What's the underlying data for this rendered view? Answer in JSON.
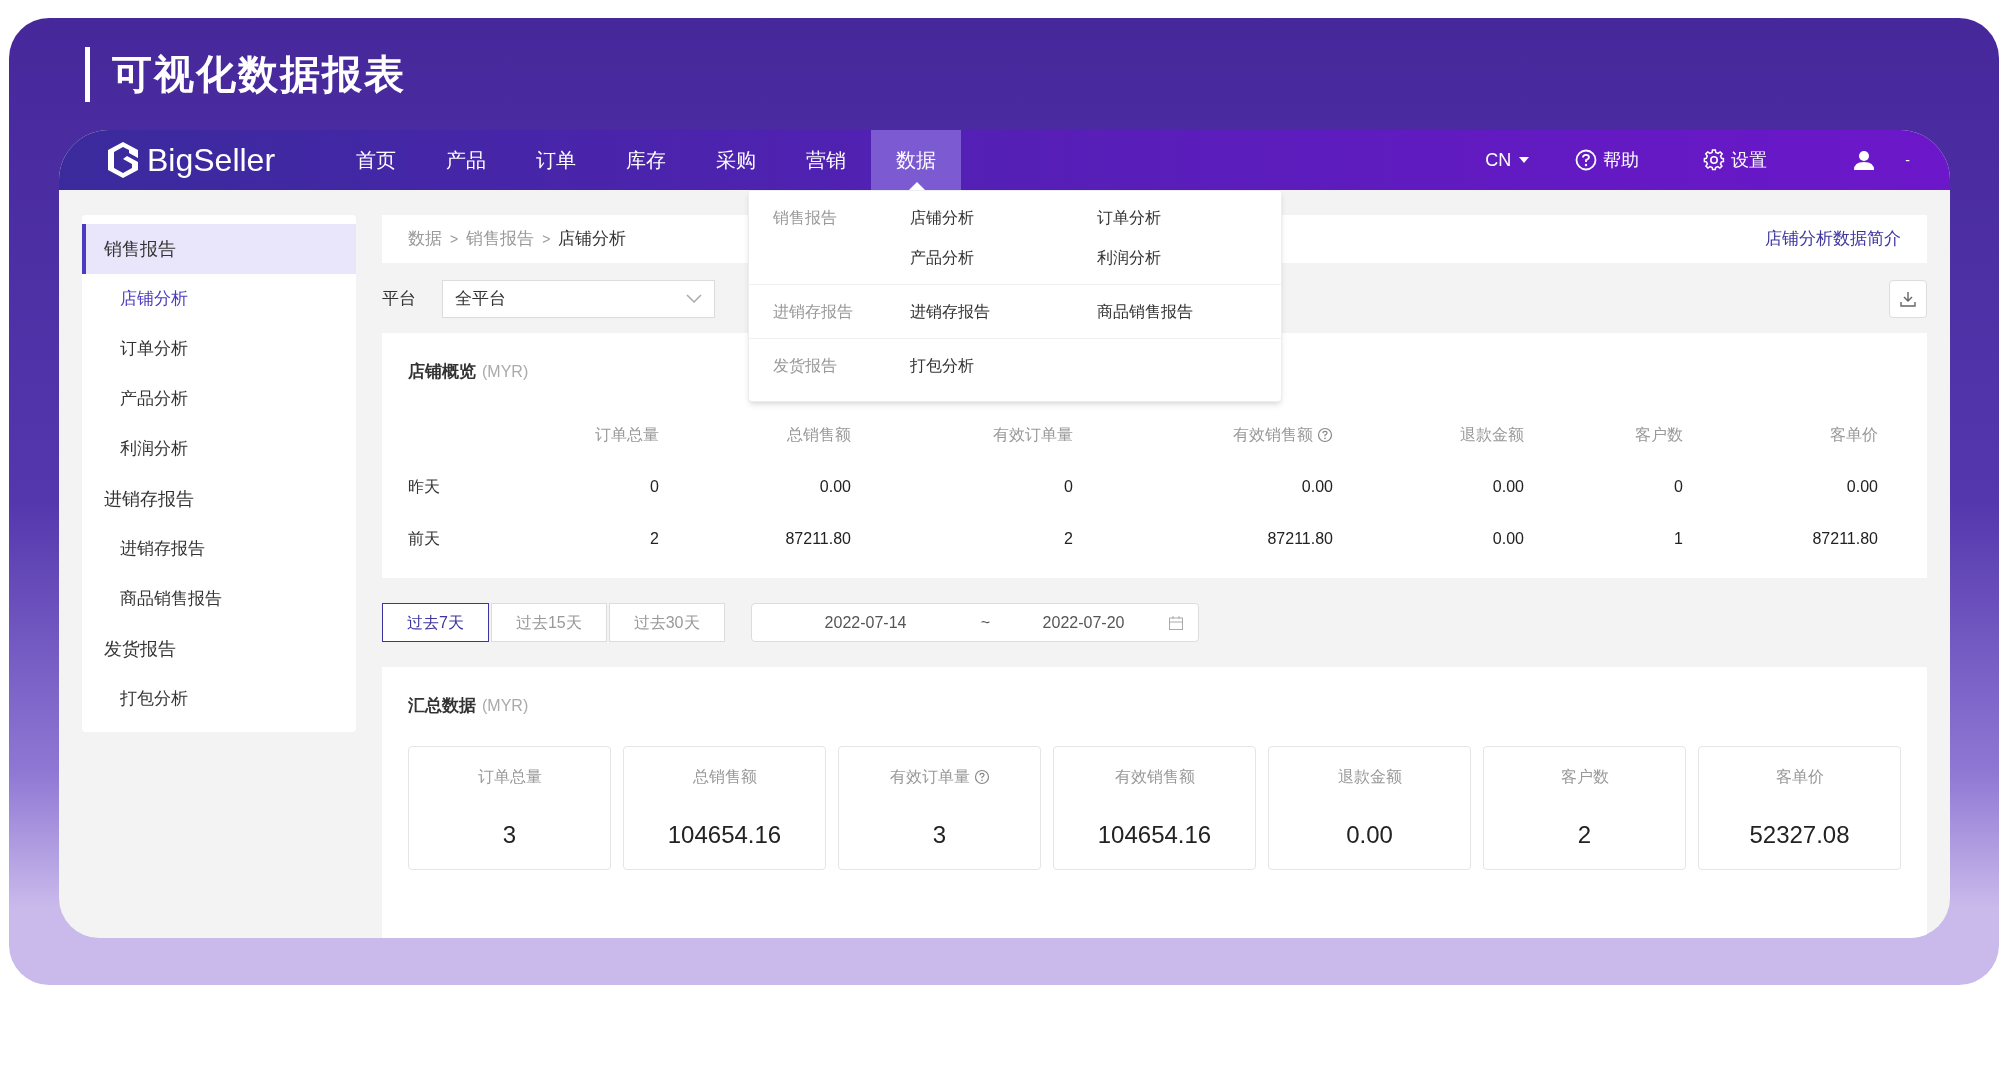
{
  "banner": {
    "title": "可视化数据报表"
  },
  "navbar": {
    "logo": "BigSeller",
    "items": [
      {
        "label": "首页",
        "selected": false
      },
      {
        "label": "产品",
        "selected": false
      },
      {
        "label": "订单",
        "selected": false
      },
      {
        "label": "库存",
        "selected": false
      },
      {
        "label": "采购",
        "selected": false
      },
      {
        "label": "营销",
        "selected": false
      },
      {
        "label": "数据",
        "selected": true
      }
    ],
    "language": "CN",
    "help": "帮助",
    "settings": "设置",
    "user": "-"
  },
  "nav_menu": {
    "groups": [
      {
        "title": "销售报告",
        "items": [
          "店铺分析",
          "订单分析",
          "产品分析",
          "利润分析"
        ]
      },
      {
        "title": "进销存报告",
        "items": [
          "进销存报告",
          "商品销售报告"
        ]
      },
      {
        "title": "发货报告",
        "items": [
          "打包分析"
        ]
      }
    ]
  },
  "sidebar": {
    "groups": [
      {
        "label": "销售报告",
        "selected": true,
        "children": [
          {
            "label": "店铺分析",
            "selected": true
          },
          {
            "label": "订单分析",
            "selected": false
          },
          {
            "label": "产品分析",
            "selected": false
          },
          {
            "label": "利润分析",
            "selected": false
          }
        ]
      },
      {
        "label": "进销存报告",
        "selected": false,
        "children": [
          {
            "label": "进销存报告",
            "selected": false
          },
          {
            "label": "商品销售报告",
            "selected": false
          }
        ]
      },
      {
        "label": "发货报告",
        "selected": false,
        "children": [
          {
            "label": "打包分析",
            "selected": false
          }
        ]
      }
    ]
  },
  "breadcrumb": {
    "items": [
      "数据",
      "销售报告",
      "店铺分析"
    ],
    "separator": ">",
    "link": "店铺分析数据简介"
  },
  "filter": {
    "label": "平台",
    "value": "全平台"
  },
  "overview": {
    "title": "店铺概览",
    "unit": "(MYR)",
    "columns": [
      {
        "label": "订单总量",
        "info": false
      },
      {
        "label": "总销售额",
        "info": false
      },
      {
        "label": "有效订单量",
        "info": false
      },
      {
        "label": "有效销售额",
        "info": true
      },
      {
        "label": "退款金额",
        "info": false
      },
      {
        "label": "客户数",
        "info": false
      },
      {
        "label": "客单价",
        "info": false
      }
    ],
    "rows": [
      {
        "label": "昨天",
        "values": [
          "0",
          "0.00",
          "0",
          "0.00",
          "0.00",
          "0",
          "0.00"
        ]
      },
      {
        "label": "前天",
        "values": [
          "2",
          "87211.80",
          "2",
          "87211.80",
          "0.00",
          "1",
          "87211.80"
        ]
      }
    ]
  },
  "date_ranges": [
    {
      "label": "过去7天",
      "selected": true
    },
    {
      "label": "过去15天",
      "selected": false
    },
    {
      "label": "过去30天",
      "selected": false
    }
  ],
  "date_range": {
    "start": "2022-07-14",
    "separator": "~",
    "end": "2022-07-20"
  },
  "summary": {
    "title": "汇总数据",
    "unit": "(MYR)",
    "cards": [
      {
        "label": "订单总量",
        "value": "3",
        "info": false
      },
      {
        "label": "总销售额",
        "value": "104654.16",
        "info": false
      },
      {
        "label": "有效订单量",
        "value": "3",
        "info": true
      },
      {
        "label": "有效销售额",
        "value": "104654.16",
        "info": false
      },
      {
        "label": "退款金额",
        "value": "0.00",
        "info": false
      },
      {
        "label": "客户数",
        "value": "2",
        "info": false
      },
      {
        "label": "客单价",
        "value": "52327.08",
        "info": false
      }
    ]
  }
}
